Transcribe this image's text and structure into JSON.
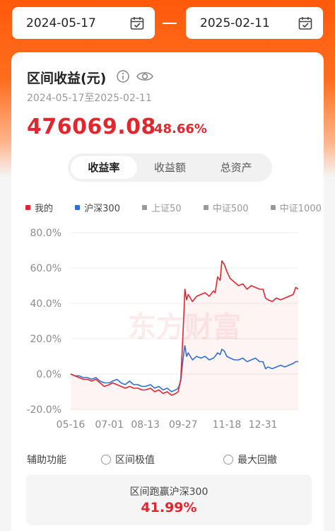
{
  "date_range": {
    "start": "2024-05-17",
    "end": "2025-02-11"
  },
  "summary": {
    "title": "区间收益(元)",
    "range_text": "2024-05-17至2025-02-11",
    "value": "476069.08",
    "percent": "48.66%"
  },
  "tabs": [
    {
      "label": "收益率",
      "active": true
    },
    {
      "label": "收益额",
      "active": false
    },
    {
      "label": "总资产",
      "active": false
    }
  ],
  "legend": [
    {
      "label": "我的",
      "color": "#e3262e",
      "muted": false
    },
    {
      "label": "沪深300",
      "color": "#2f6fd6",
      "muted": false
    },
    {
      "label": "上证50",
      "color": "#999999",
      "muted": true
    },
    {
      "label": "中证500",
      "color": "#999999",
      "muted": true
    },
    {
      "label": "中证1000",
      "color": "#999999",
      "muted": true
    }
  ],
  "watermark": "东方财富",
  "chart_data": {
    "type": "line",
    "y_ticks": [
      "80.0%",
      "60.0%",
      "40.0%",
      "20.0%",
      "0.0%",
      "-20.0%"
    ],
    "ylim": [
      -20,
      80
    ],
    "x_ticks": [
      "05-16",
      "07-01",
      "08-13",
      "09-27",
      "11-18",
      "12-31"
    ],
    "x_tick_days": [
      0,
      46,
      89,
      134,
      186,
      229
    ],
    "x_domain_days": [
      0,
      271
    ],
    "series": [
      {
        "name": "我的",
        "color": "#e3262e",
        "points": [
          [
            0,
            0
          ],
          [
            5,
            -1
          ],
          [
            10,
            -2
          ],
          [
            15,
            -3
          ],
          [
            20,
            -3
          ],
          [
            25,
            -4
          ],
          [
            30,
            -3
          ],
          [
            35,
            -5
          ],
          [
            40,
            -7
          ],
          [
            46,
            -6
          ],
          [
            50,
            -5
          ],
          [
            55,
            -6
          ],
          [
            60,
            -7
          ],
          [
            65,
            -8
          ],
          [
            70,
            -7
          ],
          [
            75,
            -8
          ],
          [
            80,
            -8
          ],
          [
            85,
            -9
          ],
          [
            89,
            -9
          ],
          [
            95,
            -8
          ],
          [
            100,
            -10
          ],
          [
            105,
            -9
          ],
          [
            110,
            -11
          ],
          [
            115,
            -10
          ],
          [
            120,
            -12
          ],
          [
            125,
            -11
          ],
          [
            128,
            -10
          ],
          [
            131,
            -3
          ],
          [
            133,
            15
          ],
          [
            135,
            36
          ],
          [
            136,
            48
          ],
          [
            138,
            42
          ],
          [
            140,
            45
          ],
          [
            145,
            41
          ],
          [
            150,
            44
          ],
          [
            155,
            45
          ],
          [
            160,
            46
          ],
          [
            165,
            44
          ],
          [
            170,
            47
          ],
          [
            172,
            46
          ],
          [
            175,
            55
          ],
          [
            178,
            53
          ],
          [
            180,
            64
          ],
          [
            183,
            62
          ],
          [
            186,
            58
          ],
          [
            190,
            54
          ],
          [
            195,
            52
          ],
          [
            200,
            50
          ],
          [
            205,
            51
          ],
          [
            210,
            48
          ],
          [
            215,
            50
          ],
          [
            220,
            49
          ],
          [
            225,
            48
          ],
          [
            229,
            48
          ],
          [
            232,
            43
          ],
          [
            235,
            42
          ],
          [
            240,
            41
          ],
          [
            245,
            43
          ],
          [
            250,
            42
          ],
          [
            255,
            43
          ],
          [
            260,
            44
          ],
          [
            265,
            45
          ],
          [
            268,
            49
          ],
          [
            271,
            48
          ]
        ]
      },
      {
        "name": "沪深300",
        "color": "#2f6fd6",
        "points": [
          [
            0,
            0
          ],
          [
            5,
            -1
          ],
          [
            10,
            -1
          ],
          [
            15,
            -2
          ],
          [
            20,
            -2
          ],
          [
            25,
            -3
          ],
          [
            30,
            -2
          ],
          [
            35,
            -4
          ],
          [
            40,
            -5
          ],
          [
            46,
            -5
          ],
          [
            50,
            -4
          ],
          [
            55,
            -3
          ],
          [
            60,
            -5
          ],
          [
            65,
            -6
          ],
          [
            70,
            -4
          ],
          [
            75,
            -6
          ],
          [
            80,
            -6
          ],
          [
            85,
            -7
          ],
          [
            89,
            -7
          ],
          [
            95,
            -6
          ],
          [
            100,
            -8
          ],
          [
            105,
            -7
          ],
          [
            110,
            -9
          ],
          [
            115,
            -8
          ],
          [
            120,
            -10
          ],
          [
            125,
            -9
          ],
          [
            128,
            -8
          ],
          [
            131,
            -4
          ],
          [
            133,
            5
          ],
          [
            135,
            13
          ],
          [
            136,
            16
          ],
          [
            138,
            10
          ],
          [
            140,
            12
          ],
          [
            145,
            8
          ],
          [
            150,
            10
          ],
          [
            155,
            9
          ],
          [
            160,
            10
          ],
          [
            165,
            8
          ],
          [
            170,
            9
          ],
          [
            172,
            10
          ],
          [
            175,
            12
          ],
          [
            178,
            11
          ],
          [
            180,
            14
          ],
          [
            183,
            13
          ],
          [
            186,
            10
          ],
          [
            190,
            9
          ],
          [
            195,
            8
          ],
          [
            200,
            8
          ],
          [
            205,
            9
          ],
          [
            210,
            7
          ],
          [
            215,
            8
          ],
          [
            220,
            9
          ],
          [
            225,
            7
          ],
          [
            229,
            7
          ],
          [
            232,
            3
          ],
          [
            235,
            4
          ],
          [
            240,
            3
          ],
          [
            245,
            4
          ],
          [
            250,
            5
          ],
          [
            255,
            4
          ],
          [
            260,
            5
          ],
          [
            265,
            6
          ],
          [
            268,
            7
          ],
          [
            271,
            7
          ]
        ]
      }
    ]
  },
  "aux": {
    "label": "辅助功能",
    "option1": "区间极值",
    "option2": "最大回撤"
  },
  "beat": {
    "label": "区间跑赢沪深300",
    "value": "41.99%"
  }
}
